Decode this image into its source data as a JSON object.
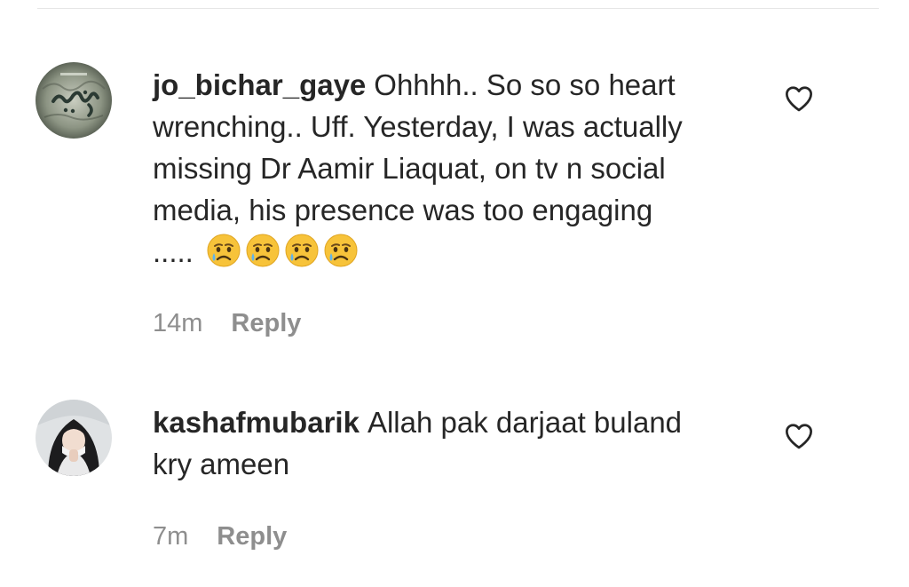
{
  "comments": [
    {
      "username": "jo_bichar_gaye",
      "text_lines": [
        "Ohhhh.. So so so heart",
        "wrenching.. Uff. Yesterday, I was actually",
        "missing Dr Aamir Liaquat, on tv n social",
        "media, his presence was too engaging",
        "....."
      ],
      "emojis": [
        "crying-face-emoji",
        "crying-face-emoji",
        "crying-face-emoji",
        "crying-face-emoji"
      ],
      "time": "14m",
      "reply_label": "Reply",
      "avatar": "profile-picture-urdu-calligraphy",
      "like_icon": "heart-outline-icon"
    },
    {
      "username": "kashafmubarik",
      "text_lines": [
        "Allah pak darjaat buland",
        "kry ameen"
      ],
      "time": "7m",
      "reply_label": "Reply",
      "avatar": "profile-picture-hijab-person",
      "like_icon": "heart-outline-icon"
    }
  ],
  "colors": {
    "text": "#262626",
    "meta": "#8e8e8e",
    "divider": "#e6e6e6"
  }
}
